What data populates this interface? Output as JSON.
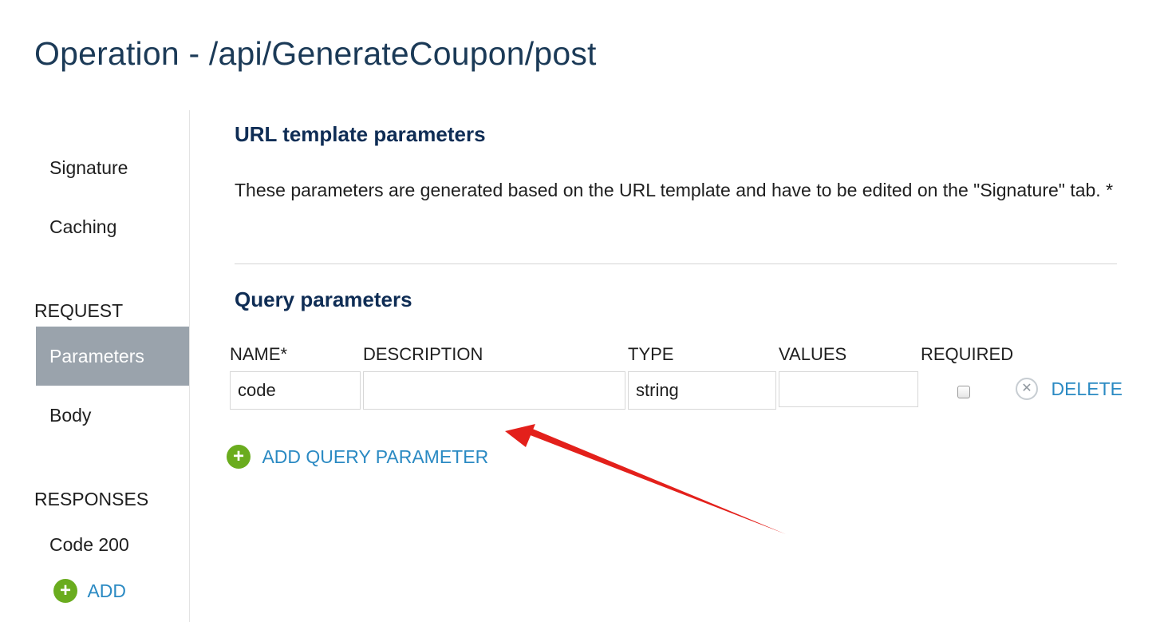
{
  "page": {
    "title": "Operation - /api/GenerateCoupon/post"
  },
  "sidebar": {
    "items_top": [
      {
        "label": "Signature"
      },
      {
        "label": "Caching"
      }
    ],
    "request_section": "REQUEST",
    "request_items": [
      {
        "label": "Parameters",
        "active": true
      },
      {
        "label": "Body"
      }
    ],
    "responses_section": "RESPONSES",
    "response_items": [
      {
        "label": "Code 200"
      }
    ],
    "add_label": "ADD"
  },
  "main": {
    "url_template": {
      "heading": "URL template parameters",
      "description": "These parameters are generated based on the URL template and have to be edited on the \"Signature\" tab. *"
    },
    "query": {
      "heading": "Query parameters",
      "columns": [
        "NAME*",
        "DESCRIPTION",
        "TYPE",
        "VALUES",
        "REQUIRED"
      ],
      "rows": [
        {
          "name": "code",
          "description": "",
          "type": "string",
          "values": "",
          "required": false,
          "delete_label": "DELETE"
        }
      ],
      "add_label": "ADD QUERY PARAMETER"
    }
  },
  "colors": {
    "title": "#1b3a57",
    "heading": "#0f2d55",
    "link": "#2b8ac3",
    "active_nav_bg": "#9aa3ac",
    "add_icon": "#6aac1e",
    "annotation_arrow": "#e3201b"
  },
  "icons": {
    "add": "plus-circle-icon",
    "delete": "close-circle-icon",
    "annotation": "red-arrow-annotation"
  }
}
